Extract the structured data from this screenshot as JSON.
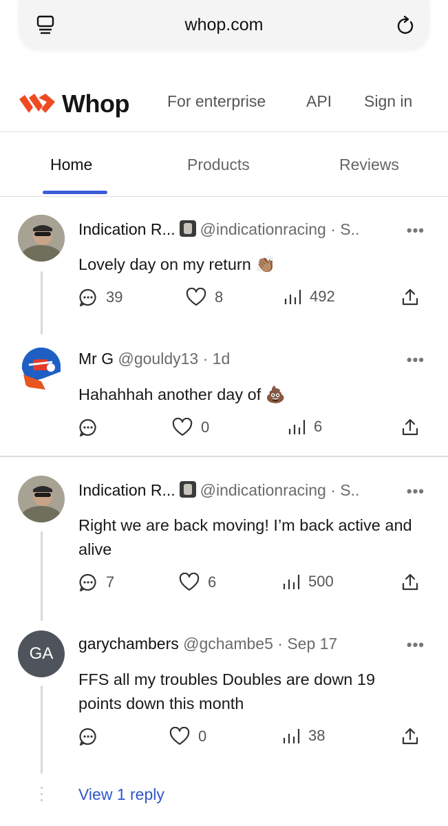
{
  "browser": {
    "url": "whop.com",
    "tabs_icon": "tabs-icon",
    "reload_icon": "reload-icon"
  },
  "header": {
    "brand": "Whop",
    "brand_color": "#ef4a23",
    "nav": [
      "For enterprise",
      "API",
      "Sign in"
    ]
  },
  "tabs": {
    "items": [
      "Home",
      "Products",
      "Reviews"
    ],
    "active": "Home",
    "accent": "#3b5bdb"
  },
  "posts": [
    {
      "name": "Indication R...",
      "handle": "@indicationracing · S..",
      "text": "Lovely day on my return 👏🏽",
      "comments": "39",
      "likes": "8",
      "views": "492"
    },
    {
      "name": "Mr G",
      "handle": "@gouldy13 · 1d",
      "text": "Hahahhah another day of 💩",
      "comments": "",
      "likes": "0",
      "views": "6"
    },
    {
      "name": "Indication R...",
      "handle": "@indicationracing · S..",
      "text": "Right we are back moving! I’m back active and alive",
      "comments": "7",
      "likes": "6",
      "views": "500"
    },
    {
      "name": "garychambers",
      "handle": "@gchambe5 · Sep 17",
      "avatar_initials": "GA",
      "text": "FFS all my troubles Doubles are down 19 points down this month",
      "comments": "",
      "likes": "0",
      "views": "38"
    }
  ],
  "view_reply": "View 1 reply",
  "more_glyph": "•••"
}
